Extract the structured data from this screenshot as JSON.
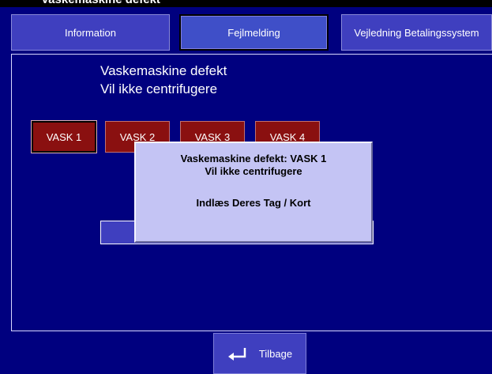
{
  "header": {
    "title_fragment": "Vaskemaskine defekt"
  },
  "tabs": [
    {
      "label": "Information"
    },
    {
      "label": "Fejlmelding"
    },
    {
      "label": "Vejledning Betalingssystem"
    }
  ],
  "message": {
    "line1": "Vaskemaskine defekt",
    "line2": "Vil ikke centrifugere"
  },
  "machines": [
    {
      "label": "VASK 1"
    },
    {
      "label": "VASK 2"
    },
    {
      "label": "VASK 3"
    },
    {
      "label": "VASK 4"
    }
  ],
  "popup": {
    "line1": "Vaskemaskine defekt: VASK 1",
    "line2": "Vil ikke centrifugere",
    "line3": "Indlæs Deres Tag / Kort"
  },
  "footer": {
    "back_label": "Tilbage",
    "back_icon": "return-arrow-icon"
  },
  "colors": {
    "background": "#00007f",
    "button": "#3f3fbf",
    "machine": "#8a1010",
    "popup": "#c4c4f4"
  }
}
